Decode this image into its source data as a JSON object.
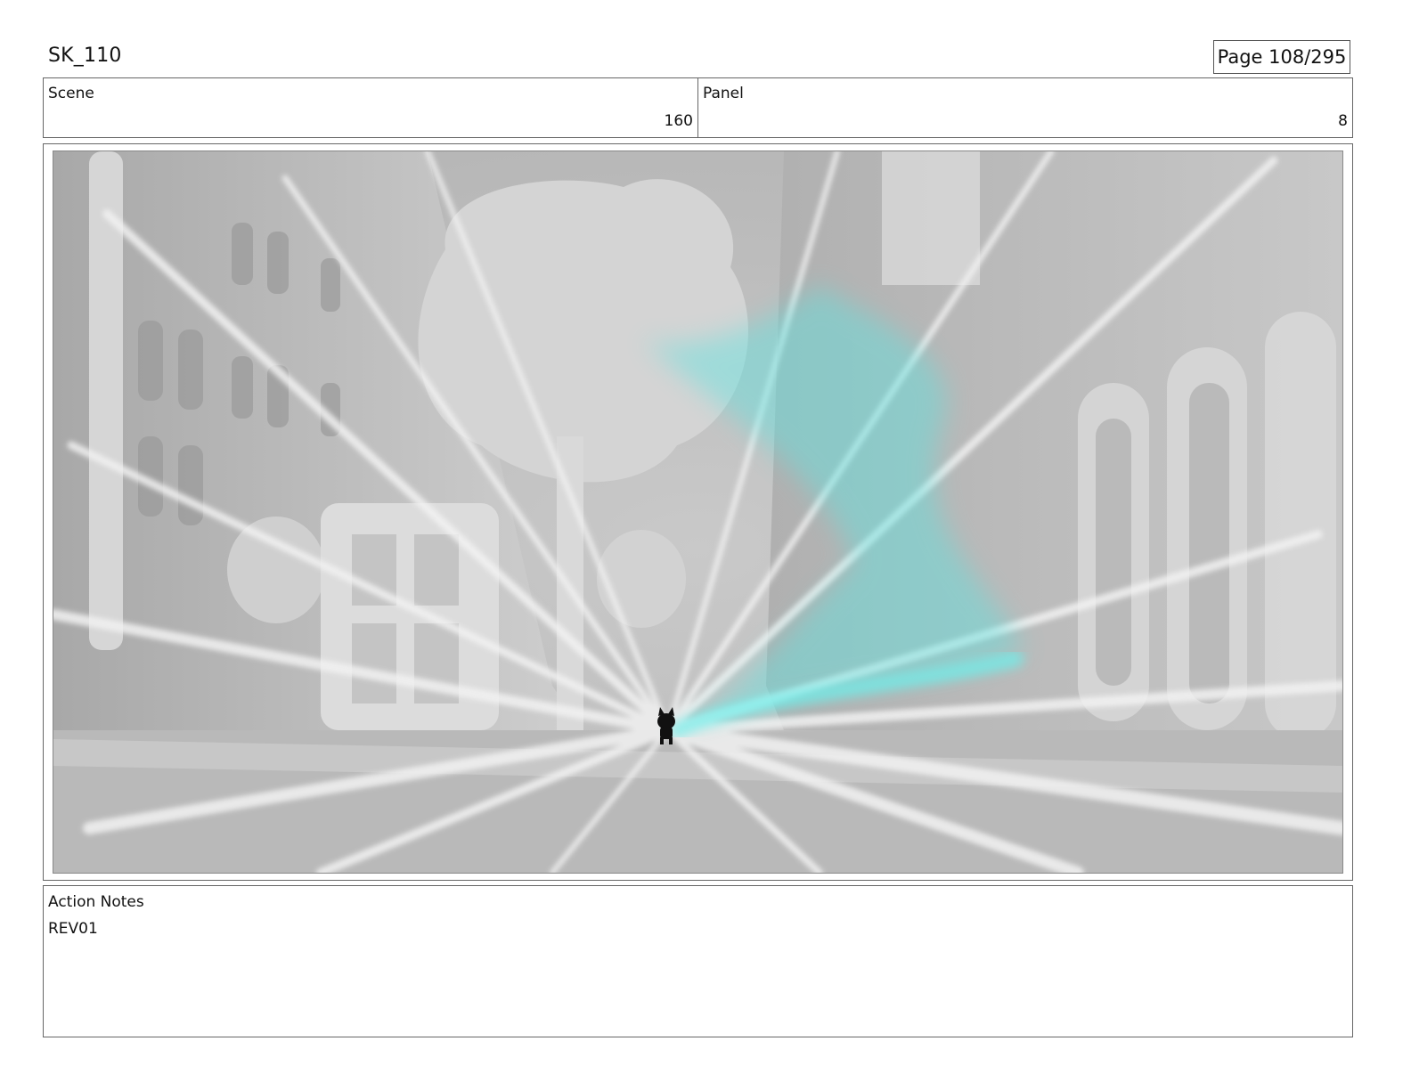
{
  "header": {
    "sequence": "SK_110",
    "page": "Page 108/295"
  },
  "scene": {
    "label": "Scene",
    "value": "160"
  },
  "panel": {
    "label": "Panel",
    "value": "8"
  },
  "notes": {
    "label": "Action Notes",
    "text": "REV01"
  },
  "colors": {
    "frame_gray": "#bdbdbd",
    "trail_cyan": "#5fe3e0",
    "character": "#111111"
  }
}
